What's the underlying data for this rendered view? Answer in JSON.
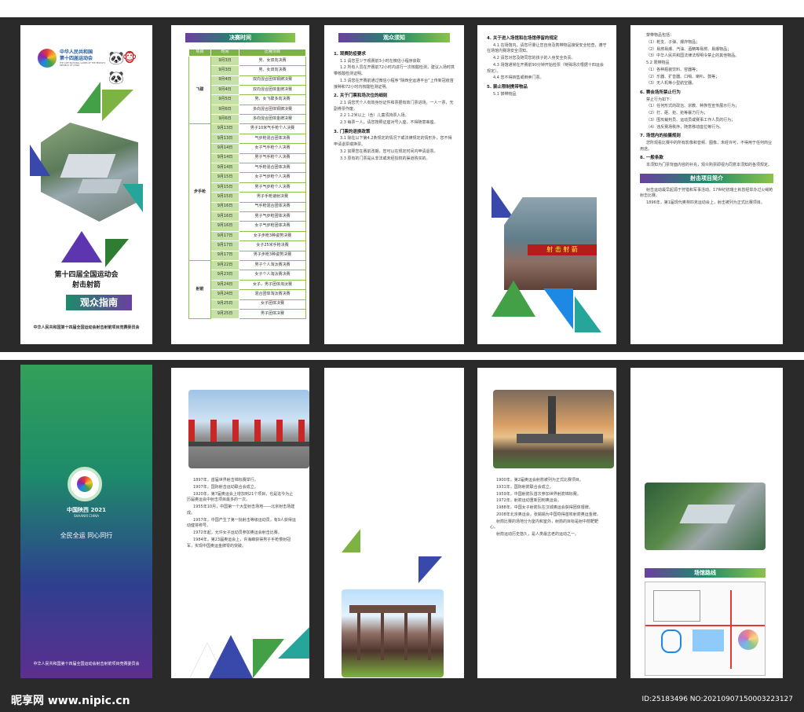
{
  "cover": {
    "logo_text_line1": "中华人民共和国",
    "logo_text_line2": "第十四届运动会",
    "logo_text_en": "THE 14TH NATIONAL GAMES OF THE PEOPLE'S REPUBLIC OF CHINA",
    "logo_sub": "SHAANXI 2021",
    "title_line1": "第十四届全国运动会",
    "title_line2": "射击射箭",
    "guide": "观众指南",
    "organizer": "中华人民共和国第十四届全国运动会射击射箭项目竞赛委员会"
  },
  "schedule": {
    "heading": "决赛时间",
    "columns": [
      "项目",
      "时间",
      "比赛项目"
    ],
    "groups": [
      {
        "name": "飞碟",
        "rows": [
          {
            "date": "9月3日",
            "event": "男、女双向决赛"
          },
          {
            "date": "9月3日",
            "event": "男、女双向决赛"
          },
          {
            "date": "9月4日",
            "event": "双向混合团体铜牌决赛"
          },
          {
            "date": "9月4日",
            "event": "双向混合团体金牌决赛"
          },
          {
            "date": "9月5日",
            "event": "男、女飞碟多向决赛"
          },
          {
            "date": "9月6日",
            "event": "多向混合团体铜牌决赛"
          },
          {
            "date": "9月6日",
            "event": "多向混合团体金牌决赛"
          }
        ]
      },
      {
        "name": "步手枪",
        "rows": [
          {
            "date": "9月13日",
            "event": "男子10米气手枪个人决赛"
          },
          {
            "date": "9月13日",
            "event": "气步枪混合团体决赛"
          },
          {
            "date": "9月14日",
            "event": "女子气手枪个人决赛"
          },
          {
            "date": "9月14日",
            "event": "男子气手枪个人决赛"
          },
          {
            "date": "9月14日",
            "event": "气手枪混合团体决赛"
          },
          {
            "date": "9月15日",
            "event": "女子气步枪个人决赛"
          },
          {
            "date": "9月15日",
            "event": "男子气步枪个人决赛"
          },
          {
            "date": "9月15日",
            "event": "男子手枪速射决赛"
          },
          {
            "date": "9月16日",
            "event": "气手枪混合团体决赛"
          },
          {
            "date": "9月16日",
            "event": "男子气步枪团体决赛"
          },
          {
            "date": "9月16日",
            "event": "女子气步枪团体决赛"
          },
          {
            "date": "9月17日",
            "event": "女子步枪3种姿势决赛"
          },
          {
            "date": "9月17日",
            "event": "女子25米手枪决赛"
          },
          {
            "date": "9月17日",
            "event": "男子步枪3种姿势决赛"
          }
        ]
      },
      {
        "name": "射箭",
        "rows": [
          {
            "date": "9月22日",
            "event": "男子个人淘汰赛决赛"
          },
          {
            "date": "9月23日",
            "event": "女子个人淘汰赛决赛"
          },
          {
            "date": "9月24日",
            "event": "女子、男子团体淘汰赛"
          },
          {
            "date": "9月24日",
            "event": "混合团体淘汰赛决赛"
          },
          {
            "date": "9月25日",
            "event": "女子团体决赛"
          },
          {
            "date": "9月25日",
            "event": "男子团体决赛"
          }
        ]
      }
    ]
  },
  "notice": {
    "heading": "观众须知",
    "s1_title": "1. 观赛防疫要求",
    "s1_p1": "1.1 请您至少于观赛前3小时在微信小程序获取",
    "s1_p2": "1.2 所有人员在开赛前72小时内进行一次核酸检测，建议入场时携带核酸检测证明。",
    "s1_p3": "1.3 请您在开赛前通过微信小程序“陕西全运通平台”上传新冠疫苗接种和72小时内核酸检测证明。",
    "s2_title": "2. 关于门票和场次位的细则",
    "s2_p1": "2.1 请您凭个人有效身份证件和票据有效门票进场，一人一票，无副券票作废。",
    "s2_p2": "2.2 1.2米以上（含）儿童须持票入场。",
    "s2_p3": "2.3 每票一人，请您按照证座对号入座，不得随意串座。",
    "s3_title": "3. 门票的退换政策",
    "s3_p1": "3.1 除在以下第4.2条规定的情况下或法律规定的情形外，您不得申请退票或换票。",
    "s3_p2": "3.2 如果您在赛前改期，您可以在规定时间内申请退票。",
    "s3_p3": "3.3 原有的门票是从非法或未经授权的渠道购买的。"
  },
  "rules": {
    "s4_title": "4. 关于进入场馆和在场馆停留的规定",
    "s4_p1": "4.1 在场馆内，请您尽量让您自身及携带物品接受安全检查，遵守在场馆内赛场安全须知。",
    "s4_p2": "4.2 请您对您及随同您的孩子的人身安全负责。",
    "s4_p3": "4.3 场馆通常在开赛前90分钟开始检票（特殊场次根据十四运会规定）。",
    "s4_p4": "4.4 您不得转售或倒卖门票。",
    "s5_title": "5. 禁止限制携带物品",
    "s5_p1": "5.1 禁带物品"
  },
  "rules2": {
    "p1": "禁带物品包括：",
    "p2": "（1）枪支、子弹、爆炸物品；",
    "p3": "（2）易燃易爆、汽油、酒精等易燃、易爆物品；",
    "p4": "（3）中华人民共和国法律法规明令禁止的其他物品。",
    "p5": "5.2 限带物品",
    "p6": "（1）各种瓶装饮料、容器等；",
    "p7": "（2）乐器、扩音器、口哨、喇叭、鼓等；",
    "p8": "（3）无人机等小型航空器。",
    "s6_title": "6. 赛会场所禁止行为",
    "s6_p1": "禁止行为如下：",
    "s6_p2": "（1）任何形式的政治、宗教、种族性宣传展示行为；",
    "s6_p3": "（2）打、砸、抢、抢等暴力行为；",
    "s6_p4": "（3）围攻裁判员、运动员或赛事工作人员的行为；",
    "s6_p5": "（4）违反赛场秩序，随意移动座位等行为。",
    "s7_title": "7. 场馆内的拍摄规则",
    "s7_p1": "您所观看比赛中的所有影像和音频、图像，未经许可，不得用于任何商业用途。",
    "s8_title": "8. 一般条款",
    "s8_p1": "本须知为门票背面内容的补充，观众购票即视为同意本须知的各项规定。",
    "intro_heading": "射击项目简介",
    "intro_p1": "射击运动最早起源于狩猎和军事活动。17世纪初瑞士就曾经举办过火绳枪射击比赛。",
    "intro_p2": "1896年，第1届现代奥林匹克运动会上，射击被列为正式比赛项目。"
  },
  "back": {
    "logo_sub": "中国陕西 2021",
    "logo_sub_en": "SHAANXI CHINA",
    "slogan": "全民全运  同心同行",
    "organizer": "中华人民共和国第十四届全国运动会射击射箭项目竞赛委员会"
  },
  "history1": {
    "p1": "1897年，首届世界射击锦标赛举行。",
    "p2": "1907年，国际射击运动联合会成立。",
    "p3": "1920年，第7届奥运会上增加到21个项目，也是迄今为止历届奥运会中射击项目最多的一次。",
    "p4": "1955年10月，中国第一个大型射击场地——北京射击场建成。",
    "p5": "1957年，中国产生了第一批射击等级运动员，有9人获得运动健将称号。",
    "p6": "1972年起，允许女子运动员参加奥运会射击比赛。",
    "p7": "1984年，第23届奥运会上，许海峰获得男子手枪慢射冠军，实现中国奥运金牌零的突破。"
  },
  "history2": {
    "p1": "1900年，第2届奥运会射箭被列为正式比赛项目。",
    "p2": "1931年，国际射箭联合会成立。",
    "p3": "1959年，中国射箭队首次参加世界射箭锦标赛。",
    "p4": "1972年，射箭运动重新回到奥运会。",
    "p5": "1988年，中国女子射箭队在汉城奥运会获得团体银牌。",
    "p6": "2008年北京奥运会，张娟娟为中国夺得首枚射箭奥运金牌。",
    "p7": "射箭比赛的场地分为室内和室外，射箭的目标是射中箭靶靶心。",
    "p8": "射箭运动历史悠久，是人类最古老的运动之一。"
  },
  "route": {
    "heading": "场馆路线"
  },
  "watermark": {
    "site": "昵享网 www.nipic.cn",
    "id": "ID:25183496 NO:20210907150003223127"
  }
}
